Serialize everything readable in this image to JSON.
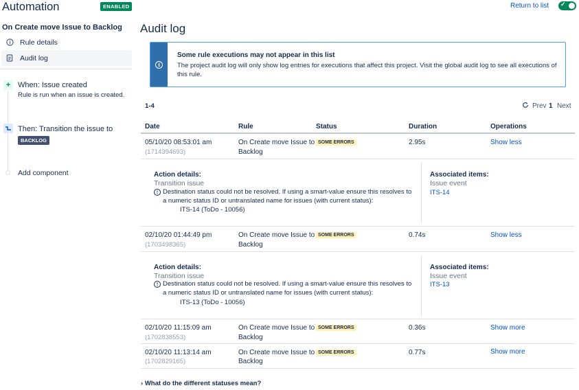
{
  "app": {
    "title": "Automation",
    "status_badge": "ENABLED",
    "return_link": "Return to list",
    "toggle_on": true
  },
  "sidebar": {
    "rule_name": "On Create move Issue to Backlog",
    "nav": [
      {
        "label": "Rule details",
        "icon": "info-icon",
        "active": false
      },
      {
        "label": "Audit log",
        "icon": "document-icon",
        "active": true
      }
    ],
    "trigger": {
      "title": "When: Issue created",
      "subtitle": "Rule is run when an issue is created.",
      "icon": "plus-icon"
    },
    "action": {
      "title": "Then: Transition the issue to",
      "lozenge": "BACKLOG",
      "icon": "transition-icon"
    },
    "add_component": "Add component"
  },
  "main": {
    "title": "Audit log",
    "info": {
      "title": "Some rule executions may not appear in this list",
      "body": "The project audit log will only show log entries for executions that affect this project. Visit the global audit log to see all executions of this rule."
    },
    "pagination": {
      "range": "1-4",
      "prev": "Prev",
      "current": "1",
      "next": "Next"
    },
    "columns": [
      "Date",
      "Rule",
      "Status",
      "Duration",
      "Operations"
    ],
    "rows": [
      {
        "date": "05/10/20 08:53:01 am",
        "id": "(1714394693)",
        "rule_line1": "On Create move Issue to",
        "rule_line2": "Backlog",
        "status": "SOME ERRORS",
        "duration": "2.95s",
        "operation": "Show less",
        "details": {
          "action_label": "Action details:",
          "action_name": "Transition issue",
          "message": "Destination status could not be resolved. If using a smart-value ensure this resolves to a numeric status ID or untranslated name for issues (with current status):",
          "issue": "ITS-14 (ToDo - 10056)",
          "assoc_label": "Associated items:",
          "assoc_type": "Issue event",
          "assoc_link": "ITS-14"
        }
      },
      {
        "date": "02/10/20 01:44:49 pm",
        "id": "(1703498365)",
        "rule_line1": "On Create move Issue to",
        "rule_line2": "Backlog",
        "status": "SOME ERRORS",
        "duration": "0.74s",
        "operation": "Show less",
        "details": {
          "action_label": "Action details:",
          "action_name": "Transition issue",
          "message": "Destination status could not be resolved. If using a smart-value ensure this resolves to a numeric status ID or untranslated name for issues (with current status):",
          "issue": "ITS-13 (ToDo - 10056)",
          "assoc_label": "Associated items:",
          "assoc_type": "Issue event",
          "assoc_link": "ITS-13"
        }
      },
      {
        "date": "02/10/20 11:15:09 am",
        "id": "(1702838553)",
        "rule_line1": "On Create move Issue to",
        "rule_line2": "Backlog",
        "status": "SOME ERRORS",
        "duration": "0.36s",
        "operation": "Show more"
      },
      {
        "date": "02/10/20 11:13:14 am",
        "id": "(1702829165)",
        "rule_line1": "On Create move Issue to",
        "rule_line2": "Backlog",
        "status": "SOME ERRORS",
        "duration": "0.77s",
        "operation": "Show more"
      }
    ],
    "faq": "What do the different statuses mean?"
  }
}
